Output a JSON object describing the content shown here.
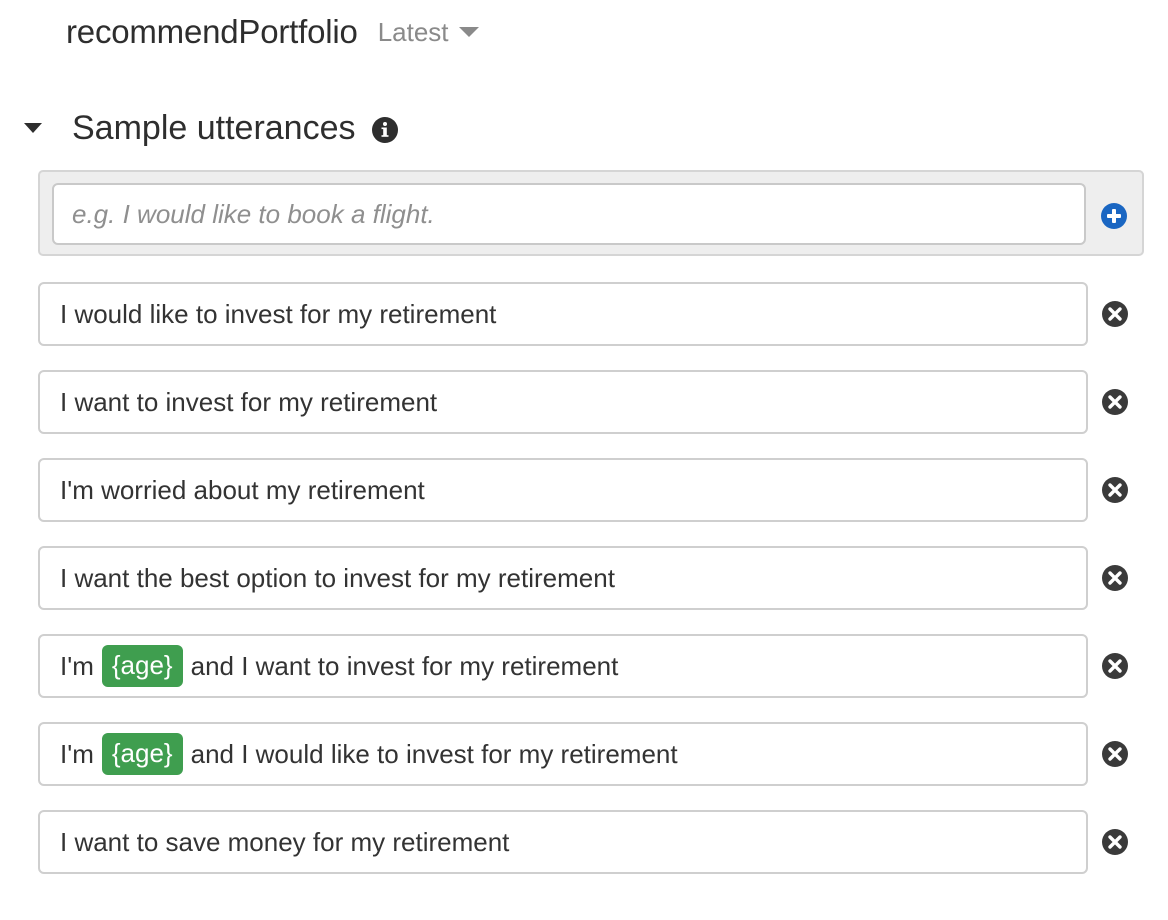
{
  "header": {
    "intent_name": "recommendPortfolio",
    "version_label": "Latest"
  },
  "section": {
    "title": "Sample utterances",
    "icons": {
      "collapse": "caret-down-icon",
      "info": "info-icon"
    }
  },
  "add_utterance": {
    "placeholder": "e.g. I would like to book a flight.",
    "value": "",
    "button_icon": "plus-circle-icon",
    "accent_color": "#1a66c2"
  },
  "utterances": [
    {
      "before": "I would like to invest for my retirement",
      "slot": "",
      "after": ""
    },
    {
      "before": "I want to invest for my retirement",
      "slot": "",
      "after": ""
    },
    {
      "before": "I'm worried about my retirement",
      "slot": "",
      "after": ""
    },
    {
      "before": "I want the best option to invest for my retirement",
      "slot": "",
      "after": ""
    },
    {
      "before": "I'm",
      "slot": "{age}",
      "after": "and I want to invest for my retirement"
    },
    {
      "before": "I'm",
      "slot": "{age}",
      "after": "and I would like to invest for my retirement"
    },
    {
      "before": "I want to save money for my retirement",
      "slot": "",
      "after": ""
    }
  ],
  "remove_icon": "close-circle-icon",
  "colors": {
    "slot_background": "#3f9e4f",
    "remove_icon": "#3a3a3a"
  }
}
